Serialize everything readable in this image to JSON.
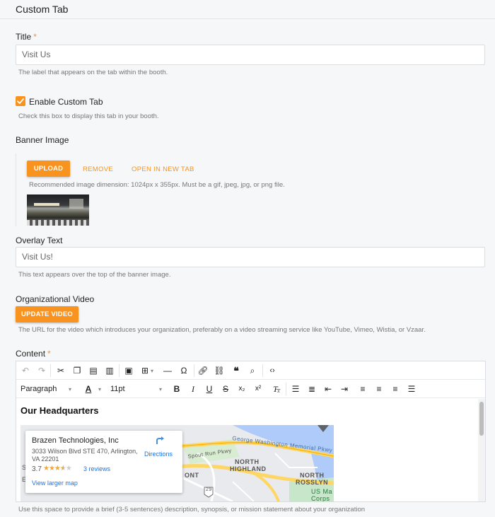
{
  "header": {
    "title": "Custom Tab"
  },
  "title_field": {
    "label": "Title",
    "required_mark": "*",
    "value": "Visit Us",
    "help": "The label that appears on the tab within the booth."
  },
  "enable_tab": {
    "checked": true,
    "label": "Enable Custom Tab",
    "help": "Check this box to display this tab in your booth."
  },
  "banner": {
    "label": "Banner Image",
    "upload_label": "UPLOAD",
    "remove_label": "REMOVE",
    "open_label": "OPEN IN NEW TAB",
    "help": "Recommended image dimension: 1024px x 355px. Must be a gif, jpeg, jpg, or png file."
  },
  "overlay": {
    "label": "Overlay Text",
    "value": "Visit Us!",
    "help": "This text appears over the top of the banner image."
  },
  "video": {
    "label": "Organizational Video",
    "button_label": "UPDATE VIDEO",
    "help": "The URL for the video which introduces your organization, preferably on a video streaming service like YouTube, Vimeo, Wistia, or Vzaar."
  },
  "content": {
    "label": "Content",
    "required_mark": "*",
    "toolbar": {
      "block_format": "Paragraph",
      "font_size": "11pt",
      "icons": [
        "undo-icon",
        "redo-icon",
        "cut-icon",
        "copy-icon",
        "paste-icon",
        "paste-text-icon",
        "image-icon",
        "table-icon",
        "horizontal-rule-icon",
        "special-char-icon",
        "link-icon",
        "unlink-icon",
        "blockquote-icon",
        "find-icon",
        "code-icon",
        "text-color-icon",
        "bold-icon",
        "italic-icon",
        "underline-icon",
        "strikethrough-icon",
        "subscript-icon",
        "superscript-icon",
        "clear-format-icon",
        "bullet-list-icon",
        "numbered-list-icon",
        "outdent-icon",
        "indent-icon",
        "align-left-icon",
        "align-center-icon",
        "align-right-icon",
        "align-justify-icon"
      ]
    },
    "heading": "Our Headquarters",
    "map": {
      "place_name": "Brazen Technologies, Inc",
      "address": "3033 Wilson Blvd STE 470, Arlington, VA 22201",
      "rating": "3.7",
      "stars": 3.7,
      "reviews": "3 reviews",
      "directions": "Directions",
      "larger_map": "View larger map",
      "labels": {
        "parkway": "George Washington Memorial Pkwy",
        "spout_run": "Spout Run Pkwy",
        "north_highland_1": "NORTH",
        "north_highland_2": "HIGHLAND",
        "north_rosslyn_1": "NORTH",
        "north_rosslyn_2": "ROSSLYN",
        "ront": "ONT",
        "us_marine_1": "US Ma",
        "us_marine_2": "Corps",
        "route": "29",
        "fragment_s": "S",
        "fragment_e": "E"
      }
    },
    "help": "Use this space to provide a brief (3-5 sentences) description, synopsis, or mission statement about your organization"
  },
  "colors": {
    "accent": "#f7931e",
    "link": "#1a73e8"
  }
}
